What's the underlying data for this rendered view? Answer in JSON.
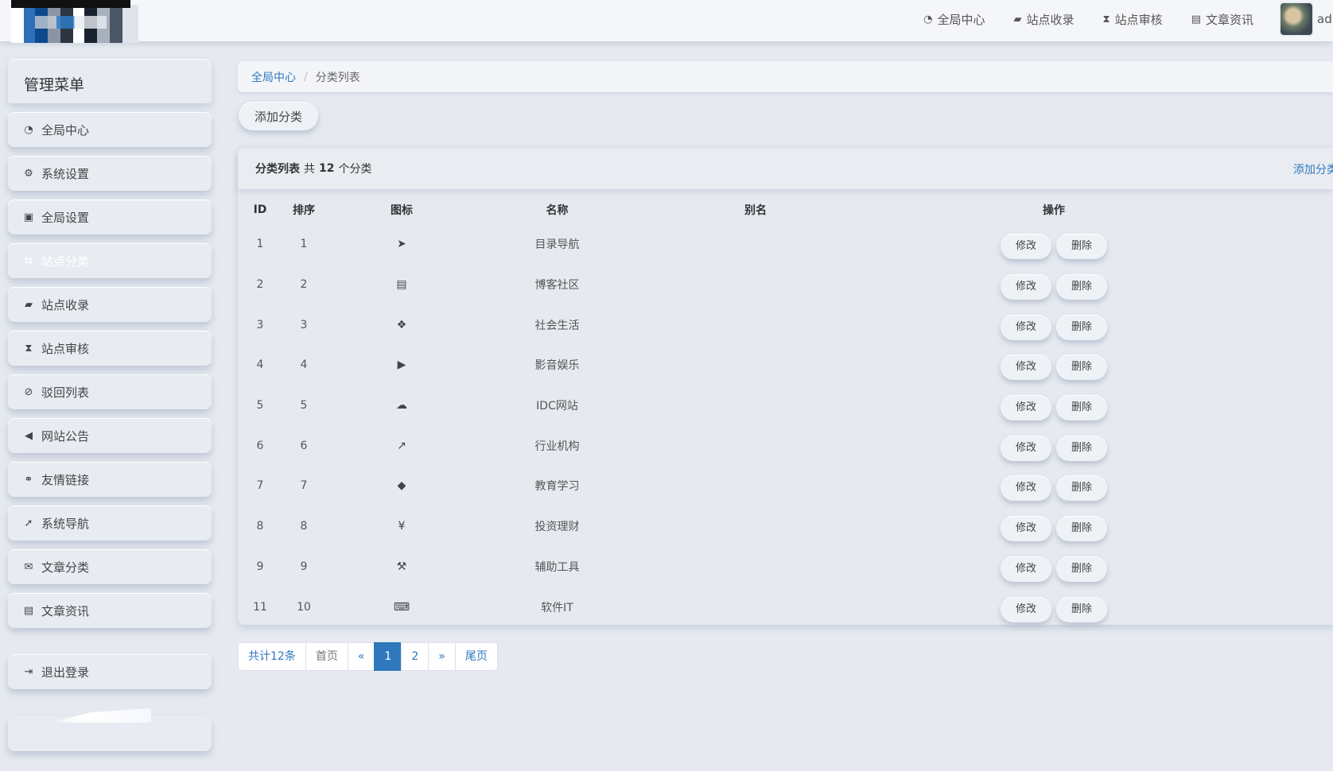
{
  "header": {
    "nav": [
      {
        "icon": "dashboard-icon",
        "glyph": "◔",
        "label": "全局中心"
      },
      {
        "icon": "book-icon",
        "glyph": "▰",
        "label": "站点收录"
      },
      {
        "icon": "hourglass-icon",
        "glyph": "⧗",
        "label": "站点审核"
      },
      {
        "icon": "newspaper-icon",
        "glyph": "▤",
        "label": "文章资讯"
      }
    ],
    "user_name": "adr"
  },
  "sidebar": {
    "title": "管理菜单",
    "items": [
      {
        "icon": "dashboard-icon",
        "glyph": "◔",
        "label": "全局中心"
      },
      {
        "icon": "gear-icon",
        "glyph": "⚙",
        "label": "系统设置"
      },
      {
        "icon": "image-icon",
        "glyph": "▣",
        "label": "全局设置"
      },
      {
        "icon": "signpost-icon",
        "glyph": "⇆",
        "label": "站点分类"
      },
      {
        "icon": "book-icon",
        "glyph": "▰",
        "label": "站点收录"
      },
      {
        "icon": "hourglass-icon",
        "glyph": "⧗",
        "label": "站点审核"
      },
      {
        "icon": "ban-icon",
        "glyph": "⊘",
        "label": "驳回列表"
      },
      {
        "icon": "bullhorn-icon",
        "glyph": "◀",
        "label": "网站公告"
      },
      {
        "icon": "handshake-icon",
        "glyph": "⚭",
        "label": "友情链接"
      },
      {
        "icon": "location-arrow-icon",
        "glyph": "➚",
        "label": "系统导航"
      },
      {
        "icon": "envelope-icon",
        "glyph": "✉",
        "label": "文章分类"
      },
      {
        "icon": "newspaper-icon",
        "glyph": "▤",
        "label": "文章资讯"
      }
    ],
    "logout": {
      "icon": "sign-out-icon",
      "glyph": "⇥",
      "label": "退出登录"
    }
  },
  "breadcrumb": {
    "home": "全局中心",
    "separator": "/",
    "current": "分类列表"
  },
  "toolbar": {
    "add_label": "添加分类"
  },
  "panel": {
    "title": "分类列表",
    "count_prefix": "共",
    "count": "12",
    "count_suffix": "个分类",
    "add_link": "添加分类"
  },
  "table": {
    "headers": {
      "id": "ID",
      "sort": "排序",
      "icon": "图标",
      "name": "名称",
      "alias": "别名",
      "ops": "操作"
    },
    "edit_label": "修改",
    "delete_label": "删除",
    "rows": [
      {
        "id": "1",
        "sort": "1",
        "icon": "paper-plane-icon",
        "glyph": "➤",
        "name": "目录导航",
        "alias": ""
      },
      {
        "id": "2",
        "sort": "2",
        "icon": "file-icon",
        "glyph": "▤",
        "name": "博客社区",
        "alias": ""
      },
      {
        "id": "3",
        "sort": "3",
        "icon": "cubes-icon",
        "glyph": "❖",
        "name": "社会生活",
        "alias": ""
      },
      {
        "id": "4",
        "sort": "4",
        "icon": "youtube-play-icon",
        "glyph": "▶",
        "name": "影音娱乐",
        "alias": ""
      },
      {
        "id": "5",
        "sort": "5",
        "icon": "cloud-icon",
        "glyph": "☁",
        "name": "IDC网站",
        "alias": ""
      },
      {
        "id": "6",
        "sort": "6",
        "icon": "line-chart-icon",
        "glyph": "↗",
        "name": "行业机构",
        "alias": ""
      },
      {
        "id": "7",
        "sort": "7",
        "icon": "graduation-cap-icon",
        "glyph": "◆",
        "name": "教育学习",
        "alias": ""
      },
      {
        "id": "8",
        "sort": "8",
        "icon": "yen-icon",
        "glyph": "¥",
        "name": "投资理财",
        "alias": ""
      },
      {
        "id": "9",
        "sort": "9",
        "icon": "wrench-icon",
        "glyph": "⚒",
        "name": "辅助工具",
        "alias": ""
      },
      {
        "id": "11",
        "sort": "10",
        "icon": "keyboard-icon",
        "glyph": "⌨",
        "name": "软件IT",
        "alias": ""
      }
    ]
  },
  "pagination": {
    "total": "共计12条",
    "first": "首页",
    "prev": "«",
    "pages": [
      "1",
      "2"
    ],
    "current": "1",
    "next": "»",
    "last": "尾页"
  },
  "colors": {
    "accent": "#2f78bd",
    "background": "#e6eaf0"
  }
}
